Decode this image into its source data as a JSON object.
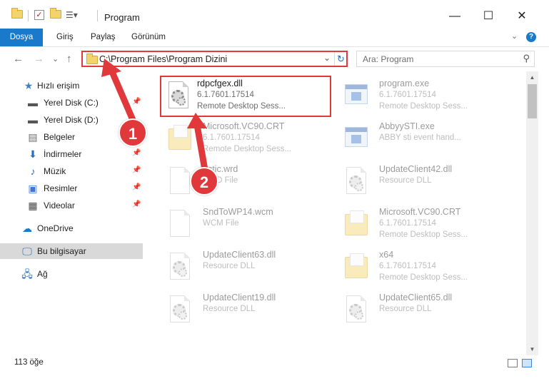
{
  "window": {
    "title": "Program",
    "minimize_glyph": "—",
    "maximize_glyph": "☐",
    "close_glyph": "✕"
  },
  "ribbon": {
    "tabs": [
      "Dosya",
      "Giriş",
      "Paylaş",
      "Görünüm"
    ],
    "expand_glyph": "⌄",
    "help_glyph": "?"
  },
  "nav": {
    "back_glyph": "←",
    "forward_glyph": "→",
    "recent_glyph": "⌄",
    "up_glyph": "↑",
    "address": "C:\\Program Files\\Program Dizini",
    "address_dropdown_glyph": "⌄",
    "refresh_glyph": "↻",
    "search_placeholder": "Ara: Program",
    "search_glyph": "⚲"
  },
  "sidebar": {
    "quick_access": "Hızlı erişim",
    "items": [
      {
        "label": "Yerel Disk (C:)",
        "icon": "drive-icon",
        "pinned": true
      },
      {
        "label": "Yerel Disk (D:)",
        "icon": "drive-icon",
        "pinned": false
      },
      {
        "label": "Belgeler",
        "icon": "documents-icon",
        "pinned": true
      },
      {
        "label": "İndirmeler",
        "icon": "downloads-icon",
        "pinned": true
      },
      {
        "label": "Müzik",
        "icon": "music-icon",
        "pinned": true
      },
      {
        "label": "Resimler",
        "icon": "pictures-icon",
        "pinned": true
      },
      {
        "label": "Videolar",
        "icon": "videos-icon",
        "pinned": true
      }
    ],
    "onedrive": "OneDrive",
    "this_pc": "Bu bilgisayar",
    "network": "Ağ",
    "pin_glyph": "📌"
  },
  "files": [
    {
      "name": "rdpcfgex.dll",
      "line2": "6.1.7601.17514",
      "line3": "Remote Desktop Sess...",
      "icon": "dll-icon",
      "highlighted": true
    },
    {
      "name": "program.exe",
      "line2": "6.1.7601.17514",
      "line3": "Remote Desktop Sess...",
      "icon": "exe-icon",
      "highlighted": false
    },
    {
      "name": "Microsoft.VC90.CRT",
      "line2": "6.1.7601.17514",
      "line3": "Remote Desktop Sess...",
      "icon": "folder-icon",
      "highlighted": false
    },
    {
      "name": "AbbyySTI.exe",
      "line2": "ABBY sti event hand...",
      "line3": "",
      "icon": "exe-icon",
      "highlighted": false
    },
    {
      "name": "actic.wrd",
      "line2": "WRD File",
      "line3": "",
      "icon": "file-icon",
      "highlighted": false
    },
    {
      "name": "UpdateClient42.dll",
      "line2": "Resource DLL",
      "line3": "",
      "icon": "dll-icon",
      "highlighted": false
    },
    {
      "name": "SndToWP14.wcm",
      "line2": "WCM File",
      "line3": "",
      "icon": "file-icon",
      "highlighted": false
    },
    {
      "name": "Microsoft.VC90.CRT",
      "line2": "6.1.7601.17514",
      "line3": "Remote Desktop Sess...",
      "icon": "folder-icon",
      "highlighted": false
    },
    {
      "name": "UpdateClient63.dll",
      "line2": "Resource DLL",
      "line3": "",
      "icon": "dll-icon",
      "highlighted": false
    },
    {
      "name": "x64",
      "line2": "6.1.7601.17514",
      "line3": "Remote Desktop Sess...",
      "icon": "folder-icon",
      "highlighted": false
    },
    {
      "name": "UpdateClient19.dll",
      "line2": "Resource DLL",
      "line3": "",
      "icon": "dll-icon",
      "highlighted": false
    },
    {
      "name": "UpdateClient65.dll",
      "line2": "Resource DLL",
      "line3": "",
      "icon": "dll-icon",
      "highlighted": false
    }
  ],
  "status": {
    "count": "113 öğe"
  },
  "annotations": {
    "step1": "1",
    "step2": "2",
    "color": "#e0383b"
  }
}
